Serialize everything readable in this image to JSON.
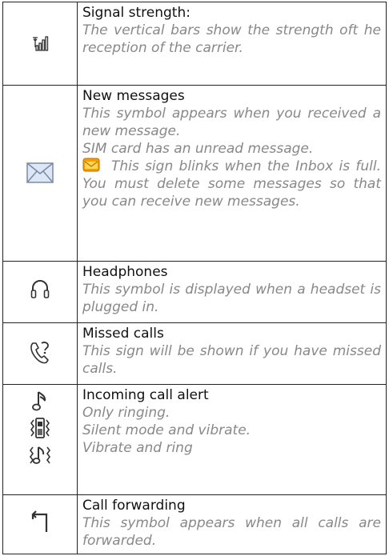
{
  "rows": [
    {
      "title": "Signal strength:",
      "text": "The vertical bars show the strength oft he reception of the carrier.",
      "icon": "signal-icon"
    },
    {
      "title": "New messages",
      "lines": [
        "This symbol appears when you received a new message.",
        "SIM card has an unread message.",
        "This sign blinks when the Inbox is full. You must delete some messages so that you can receive new messages."
      ],
      "icon": "envelope-icon",
      "inline_icon": "inbox-full-icon"
    },
    {
      "title": "Headphones",
      "text": "This symbol is displayed when a headset is plugged in.",
      "icon": "headphones-icon"
    },
    {
      "title": "Missed calls",
      "text": "This sign will be shown if you have missed calls.",
      "icon": "missed-call-icon"
    },
    {
      "title": "Incoming call alert",
      "lines": [
        "Only ringing.",
        "Silent mode and vibrate.",
        "Vibrate and ring"
      ],
      "icons": [
        "ringing-icon",
        "vibrate-icon",
        "vibrate-ring-icon"
      ]
    },
    {
      "title": "Call forwarding",
      "text": "This symbol appears when all calls are forwarded.",
      "icon": "call-forward-icon"
    }
  ]
}
